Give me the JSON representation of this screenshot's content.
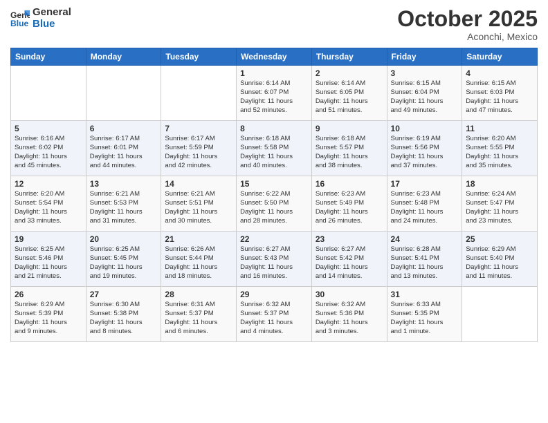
{
  "logo": {
    "line1": "General",
    "line2": "Blue"
  },
  "header": {
    "month": "October 2025",
    "location": "Aconchi, Mexico"
  },
  "weekdays": [
    "Sunday",
    "Monday",
    "Tuesday",
    "Wednesday",
    "Thursday",
    "Friday",
    "Saturday"
  ],
  "weeks": [
    [
      {
        "day": "",
        "info": ""
      },
      {
        "day": "",
        "info": ""
      },
      {
        "day": "",
        "info": ""
      },
      {
        "day": "1",
        "info": "Sunrise: 6:14 AM\nSunset: 6:07 PM\nDaylight: 11 hours\nand 52 minutes."
      },
      {
        "day": "2",
        "info": "Sunrise: 6:14 AM\nSunset: 6:05 PM\nDaylight: 11 hours\nand 51 minutes."
      },
      {
        "day": "3",
        "info": "Sunrise: 6:15 AM\nSunset: 6:04 PM\nDaylight: 11 hours\nand 49 minutes."
      },
      {
        "day": "4",
        "info": "Sunrise: 6:15 AM\nSunset: 6:03 PM\nDaylight: 11 hours\nand 47 minutes."
      }
    ],
    [
      {
        "day": "5",
        "info": "Sunrise: 6:16 AM\nSunset: 6:02 PM\nDaylight: 11 hours\nand 45 minutes."
      },
      {
        "day": "6",
        "info": "Sunrise: 6:17 AM\nSunset: 6:01 PM\nDaylight: 11 hours\nand 44 minutes."
      },
      {
        "day": "7",
        "info": "Sunrise: 6:17 AM\nSunset: 5:59 PM\nDaylight: 11 hours\nand 42 minutes."
      },
      {
        "day": "8",
        "info": "Sunrise: 6:18 AM\nSunset: 5:58 PM\nDaylight: 11 hours\nand 40 minutes."
      },
      {
        "day": "9",
        "info": "Sunrise: 6:18 AM\nSunset: 5:57 PM\nDaylight: 11 hours\nand 38 minutes."
      },
      {
        "day": "10",
        "info": "Sunrise: 6:19 AM\nSunset: 5:56 PM\nDaylight: 11 hours\nand 37 minutes."
      },
      {
        "day": "11",
        "info": "Sunrise: 6:20 AM\nSunset: 5:55 PM\nDaylight: 11 hours\nand 35 minutes."
      }
    ],
    [
      {
        "day": "12",
        "info": "Sunrise: 6:20 AM\nSunset: 5:54 PM\nDaylight: 11 hours\nand 33 minutes."
      },
      {
        "day": "13",
        "info": "Sunrise: 6:21 AM\nSunset: 5:53 PM\nDaylight: 11 hours\nand 31 minutes."
      },
      {
        "day": "14",
        "info": "Sunrise: 6:21 AM\nSunset: 5:51 PM\nDaylight: 11 hours\nand 30 minutes."
      },
      {
        "day": "15",
        "info": "Sunrise: 6:22 AM\nSunset: 5:50 PM\nDaylight: 11 hours\nand 28 minutes."
      },
      {
        "day": "16",
        "info": "Sunrise: 6:23 AM\nSunset: 5:49 PM\nDaylight: 11 hours\nand 26 minutes."
      },
      {
        "day": "17",
        "info": "Sunrise: 6:23 AM\nSunset: 5:48 PM\nDaylight: 11 hours\nand 24 minutes."
      },
      {
        "day": "18",
        "info": "Sunrise: 6:24 AM\nSunset: 5:47 PM\nDaylight: 11 hours\nand 23 minutes."
      }
    ],
    [
      {
        "day": "19",
        "info": "Sunrise: 6:25 AM\nSunset: 5:46 PM\nDaylight: 11 hours\nand 21 minutes."
      },
      {
        "day": "20",
        "info": "Sunrise: 6:25 AM\nSunset: 5:45 PM\nDaylight: 11 hours\nand 19 minutes."
      },
      {
        "day": "21",
        "info": "Sunrise: 6:26 AM\nSunset: 5:44 PM\nDaylight: 11 hours\nand 18 minutes."
      },
      {
        "day": "22",
        "info": "Sunrise: 6:27 AM\nSunset: 5:43 PM\nDaylight: 11 hours\nand 16 minutes."
      },
      {
        "day": "23",
        "info": "Sunrise: 6:27 AM\nSunset: 5:42 PM\nDaylight: 11 hours\nand 14 minutes."
      },
      {
        "day": "24",
        "info": "Sunrise: 6:28 AM\nSunset: 5:41 PM\nDaylight: 11 hours\nand 13 minutes."
      },
      {
        "day": "25",
        "info": "Sunrise: 6:29 AM\nSunset: 5:40 PM\nDaylight: 11 hours\nand 11 minutes."
      }
    ],
    [
      {
        "day": "26",
        "info": "Sunrise: 6:29 AM\nSunset: 5:39 PM\nDaylight: 11 hours\nand 9 minutes."
      },
      {
        "day": "27",
        "info": "Sunrise: 6:30 AM\nSunset: 5:38 PM\nDaylight: 11 hours\nand 8 minutes."
      },
      {
        "day": "28",
        "info": "Sunrise: 6:31 AM\nSunset: 5:37 PM\nDaylight: 11 hours\nand 6 minutes."
      },
      {
        "day": "29",
        "info": "Sunrise: 6:32 AM\nSunset: 5:37 PM\nDaylight: 11 hours\nand 4 minutes."
      },
      {
        "day": "30",
        "info": "Sunrise: 6:32 AM\nSunset: 5:36 PM\nDaylight: 11 hours\nand 3 minutes."
      },
      {
        "day": "31",
        "info": "Sunrise: 6:33 AM\nSunset: 5:35 PM\nDaylight: 11 hours\nand 1 minute."
      },
      {
        "day": "",
        "info": ""
      }
    ]
  ]
}
